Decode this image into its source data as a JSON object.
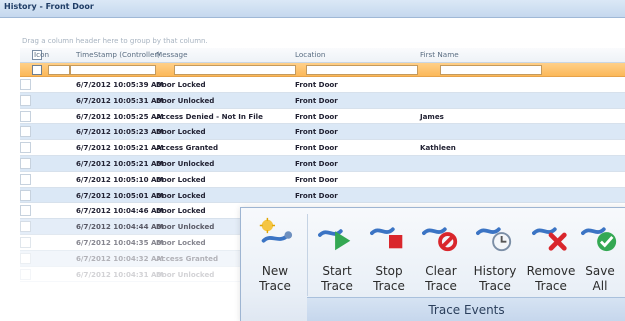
{
  "window": {
    "title": "History - Front Door"
  },
  "group_prompt": "Drag a column header here to group by that column.",
  "columns": [
    "Icon",
    "TimeStamp (Controller)",
    "Message",
    "Location",
    "First Name"
  ],
  "rows": [
    {
      "timestamp": "6/7/2012 10:05:39 AM",
      "message": "Door Locked",
      "location": "Front Door",
      "first_name": ""
    },
    {
      "timestamp": "6/7/2012 10:05:31 AM",
      "message": "Door Unlocked",
      "location": "Front Door",
      "first_name": ""
    },
    {
      "timestamp": "6/7/2012 10:05:25 AM",
      "message": "Access Denied - Not In File",
      "location": "Front Door",
      "first_name": "James"
    },
    {
      "timestamp": "6/7/2012 10:05:23 AM",
      "message": "Door Locked",
      "location": "Front Door",
      "first_name": ""
    },
    {
      "timestamp": "6/7/2012 10:05:21 AM",
      "message": "Access Granted",
      "location": "Front Door",
      "first_name": "Kathleen"
    },
    {
      "timestamp": "6/7/2012 10:05:21 AM",
      "message": "Door Unlocked",
      "location": "Front Door",
      "first_name": ""
    },
    {
      "timestamp": "6/7/2012 10:05:10 AM",
      "message": "Door Locked",
      "location": "Front Door",
      "first_name": ""
    },
    {
      "timestamp": "6/7/2012 10:05:01 AM",
      "message": "Door Locked",
      "location": "Front Door",
      "first_name": ""
    },
    {
      "timestamp": "6/7/2012 10:04:46 AM",
      "message": "Door Locked",
      "location": "",
      "first_name": ""
    },
    {
      "timestamp": "6/7/2012 10:04:44 AM",
      "message": "Door Unlocked",
      "location": "",
      "first_name": ""
    },
    {
      "timestamp": "6/7/2012 10:04:35 AM",
      "message": "Door Locked",
      "location": "",
      "first_name": ""
    },
    {
      "timestamp": "6/7/2012 10:04:32 AM",
      "message": "Access Granted",
      "location": "",
      "first_name": ""
    },
    {
      "timestamp": "6/7/2012 10:04:31 AM",
      "message": "Door Unlocked",
      "location": "",
      "first_name": ""
    }
  ],
  "ribbon": {
    "buttons": [
      {
        "label": "New Trace",
        "icon": "new-trace-icon"
      },
      {
        "label": "Start Trace",
        "icon": "start-trace-icon"
      },
      {
        "label": "Stop Trace",
        "icon": "stop-trace-icon"
      },
      {
        "label": "Clear Trace",
        "icon": "clear-trace-icon"
      },
      {
        "label": "History Trace",
        "icon": "history-trace-icon"
      },
      {
        "label": "Remove Trace",
        "icon": "remove-trace-icon"
      },
      {
        "label": "Save All",
        "icon": "save-all-icon"
      }
    ],
    "group_label": "Trace Events"
  },
  "colors": {
    "accent": "#fbb859",
    "row_alt": "#dbe8f6",
    "green": "#34a853",
    "red": "#d9262c"
  }
}
